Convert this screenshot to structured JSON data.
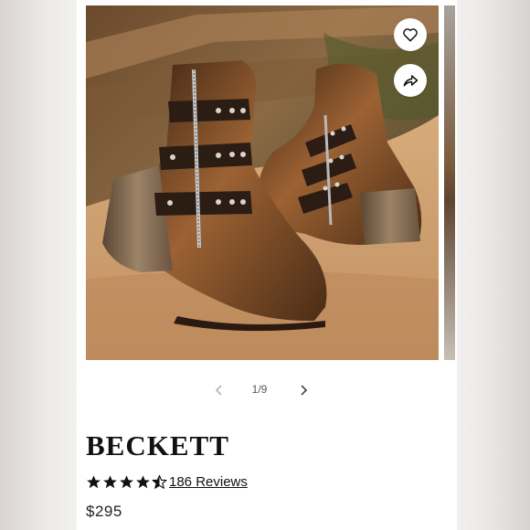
{
  "product": {
    "title": "BECKETT",
    "price": "$295",
    "rating": 4.5,
    "reviews_label": "186 Reviews"
  },
  "gallery": {
    "counter": "1/9",
    "image_alt": "Distressed brown leather zip ankle boots with studded straps on a rock",
    "prev_icon": "chevron-left-icon",
    "next_icon": "chevron-right-icon"
  },
  "actions": {
    "wishlist_icon": "heart-icon",
    "share_icon": "share-icon"
  },
  "colors": {
    "star": "#111111",
    "text": "#111111"
  }
}
